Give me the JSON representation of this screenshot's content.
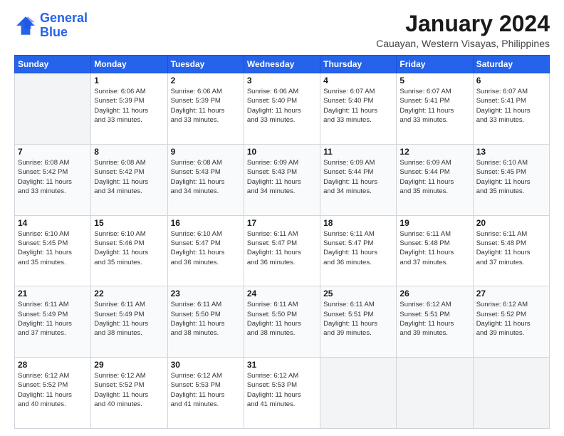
{
  "logo": {
    "line1": "General",
    "line2": "Blue"
  },
  "header": {
    "title": "January 2024",
    "subtitle": "Cauayan, Western Visayas, Philippines"
  },
  "weekdays": [
    "Sunday",
    "Monday",
    "Tuesday",
    "Wednesday",
    "Thursday",
    "Friday",
    "Saturday"
  ],
  "weeks": [
    [
      {
        "day": "",
        "info": ""
      },
      {
        "day": "1",
        "info": "Sunrise: 6:06 AM\nSunset: 5:39 PM\nDaylight: 11 hours\nand 33 minutes."
      },
      {
        "day": "2",
        "info": "Sunrise: 6:06 AM\nSunset: 5:39 PM\nDaylight: 11 hours\nand 33 minutes."
      },
      {
        "day": "3",
        "info": "Sunrise: 6:06 AM\nSunset: 5:40 PM\nDaylight: 11 hours\nand 33 minutes."
      },
      {
        "day": "4",
        "info": "Sunrise: 6:07 AM\nSunset: 5:40 PM\nDaylight: 11 hours\nand 33 minutes."
      },
      {
        "day": "5",
        "info": "Sunrise: 6:07 AM\nSunset: 5:41 PM\nDaylight: 11 hours\nand 33 minutes."
      },
      {
        "day": "6",
        "info": "Sunrise: 6:07 AM\nSunset: 5:41 PM\nDaylight: 11 hours\nand 33 minutes."
      }
    ],
    [
      {
        "day": "7",
        "info": "Sunrise: 6:08 AM\nSunset: 5:42 PM\nDaylight: 11 hours\nand 33 minutes."
      },
      {
        "day": "8",
        "info": "Sunrise: 6:08 AM\nSunset: 5:42 PM\nDaylight: 11 hours\nand 34 minutes."
      },
      {
        "day": "9",
        "info": "Sunrise: 6:08 AM\nSunset: 5:43 PM\nDaylight: 11 hours\nand 34 minutes."
      },
      {
        "day": "10",
        "info": "Sunrise: 6:09 AM\nSunset: 5:43 PM\nDaylight: 11 hours\nand 34 minutes."
      },
      {
        "day": "11",
        "info": "Sunrise: 6:09 AM\nSunset: 5:44 PM\nDaylight: 11 hours\nand 34 minutes."
      },
      {
        "day": "12",
        "info": "Sunrise: 6:09 AM\nSunset: 5:44 PM\nDaylight: 11 hours\nand 35 minutes."
      },
      {
        "day": "13",
        "info": "Sunrise: 6:10 AM\nSunset: 5:45 PM\nDaylight: 11 hours\nand 35 minutes."
      }
    ],
    [
      {
        "day": "14",
        "info": "Sunrise: 6:10 AM\nSunset: 5:45 PM\nDaylight: 11 hours\nand 35 minutes."
      },
      {
        "day": "15",
        "info": "Sunrise: 6:10 AM\nSunset: 5:46 PM\nDaylight: 11 hours\nand 35 minutes."
      },
      {
        "day": "16",
        "info": "Sunrise: 6:10 AM\nSunset: 5:47 PM\nDaylight: 11 hours\nand 36 minutes."
      },
      {
        "day": "17",
        "info": "Sunrise: 6:11 AM\nSunset: 5:47 PM\nDaylight: 11 hours\nand 36 minutes."
      },
      {
        "day": "18",
        "info": "Sunrise: 6:11 AM\nSunset: 5:47 PM\nDaylight: 11 hours\nand 36 minutes."
      },
      {
        "day": "19",
        "info": "Sunrise: 6:11 AM\nSunset: 5:48 PM\nDaylight: 11 hours\nand 37 minutes."
      },
      {
        "day": "20",
        "info": "Sunrise: 6:11 AM\nSunset: 5:48 PM\nDaylight: 11 hours\nand 37 minutes."
      }
    ],
    [
      {
        "day": "21",
        "info": "Sunrise: 6:11 AM\nSunset: 5:49 PM\nDaylight: 11 hours\nand 37 minutes."
      },
      {
        "day": "22",
        "info": "Sunrise: 6:11 AM\nSunset: 5:49 PM\nDaylight: 11 hours\nand 38 minutes."
      },
      {
        "day": "23",
        "info": "Sunrise: 6:11 AM\nSunset: 5:50 PM\nDaylight: 11 hours\nand 38 minutes."
      },
      {
        "day": "24",
        "info": "Sunrise: 6:11 AM\nSunset: 5:50 PM\nDaylight: 11 hours\nand 38 minutes."
      },
      {
        "day": "25",
        "info": "Sunrise: 6:11 AM\nSunset: 5:51 PM\nDaylight: 11 hours\nand 39 minutes."
      },
      {
        "day": "26",
        "info": "Sunrise: 6:12 AM\nSunset: 5:51 PM\nDaylight: 11 hours\nand 39 minutes."
      },
      {
        "day": "27",
        "info": "Sunrise: 6:12 AM\nSunset: 5:52 PM\nDaylight: 11 hours\nand 39 minutes."
      }
    ],
    [
      {
        "day": "28",
        "info": "Sunrise: 6:12 AM\nSunset: 5:52 PM\nDaylight: 11 hours\nand 40 minutes."
      },
      {
        "day": "29",
        "info": "Sunrise: 6:12 AM\nSunset: 5:52 PM\nDaylight: 11 hours\nand 40 minutes."
      },
      {
        "day": "30",
        "info": "Sunrise: 6:12 AM\nSunset: 5:53 PM\nDaylight: 11 hours\nand 41 minutes."
      },
      {
        "day": "31",
        "info": "Sunrise: 6:12 AM\nSunset: 5:53 PM\nDaylight: 11 hours\nand 41 minutes."
      },
      {
        "day": "",
        "info": ""
      },
      {
        "day": "",
        "info": ""
      },
      {
        "day": "",
        "info": ""
      }
    ]
  ]
}
